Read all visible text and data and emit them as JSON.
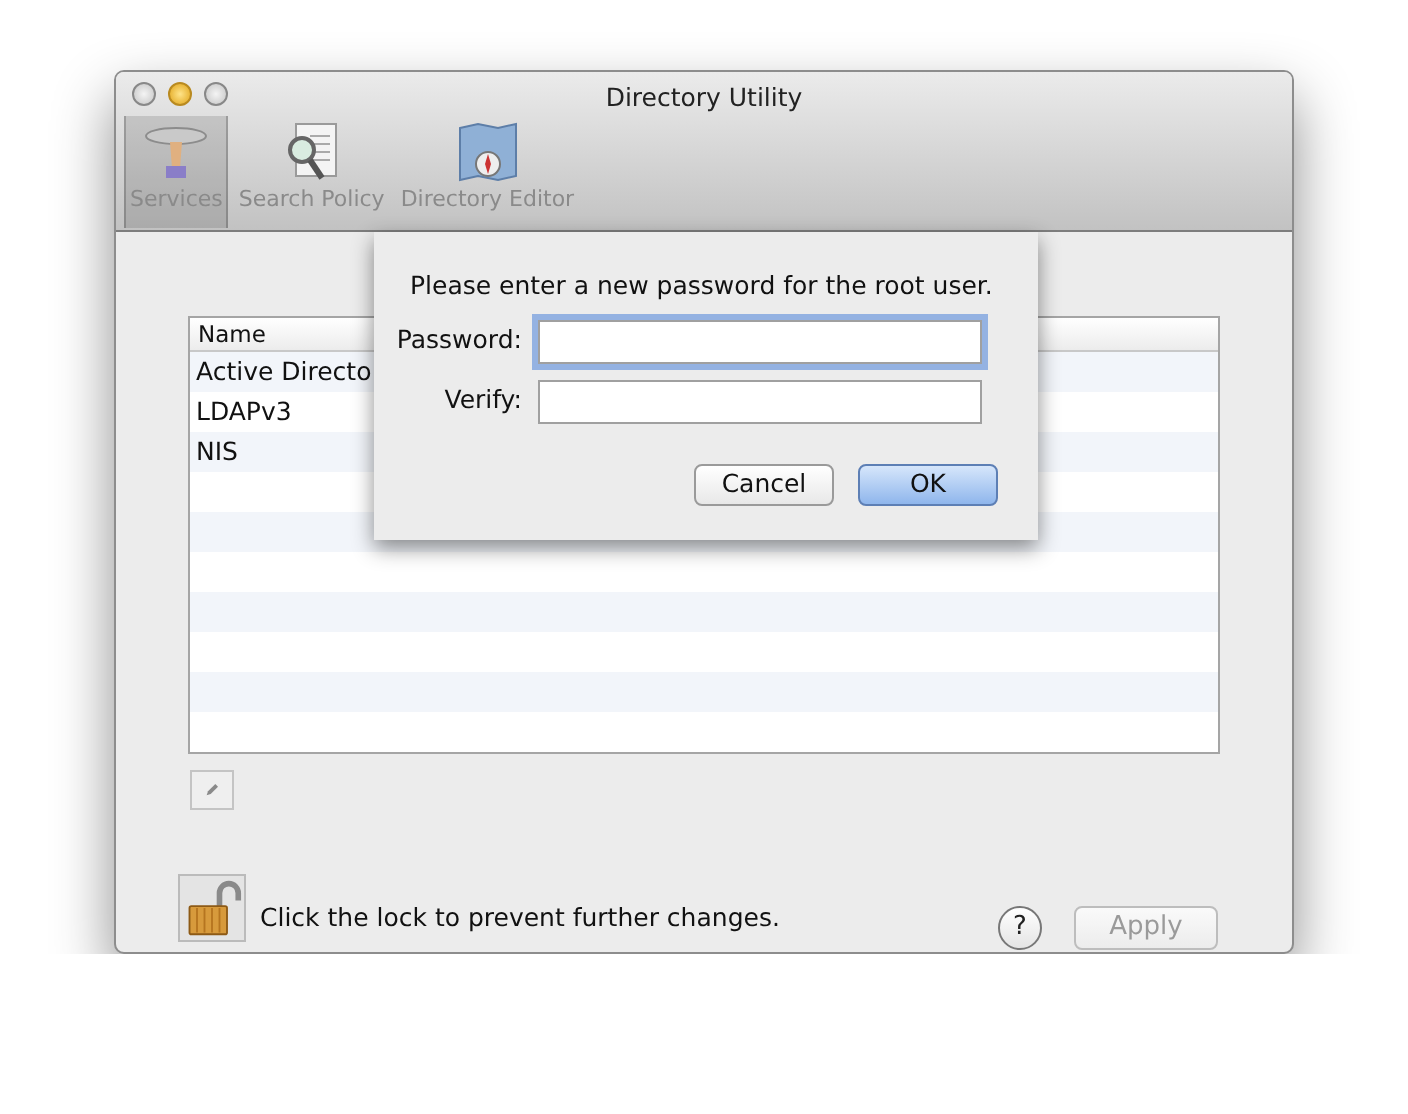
{
  "window": {
    "title": "Directory Utility"
  },
  "toolbar": [
    {
      "label": "Services",
      "selected": true
    },
    {
      "label": "Search Policy",
      "selected": false
    },
    {
      "label": "Directory Editor",
      "selected": false
    }
  ],
  "table": {
    "columns": [
      "Name"
    ],
    "rows": [
      {
        "name": "Active Directo"
      },
      {
        "name": "LDAPv3"
      },
      {
        "name": "NIS"
      }
    ]
  },
  "lock": {
    "text": "Click the lock to prevent further changes.",
    "locked": false
  },
  "help": {
    "label": "?"
  },
  "apply": {
    "label": "Apply",
    "disabled": true
  },
  "sheet": {
    "message": "Please enter a new password for the root user.",
    "fields": [
      {
        "label": "Password:",
        "focused": true
      },
      {
        "label": "Verify:",
        "focused": false
      }
    ],
    "buttons": [
      {
        "label": "Cancel",
        "default": false
      },
      {
        "label": "OK",
        "default": true
      }
    ]
  }
}
